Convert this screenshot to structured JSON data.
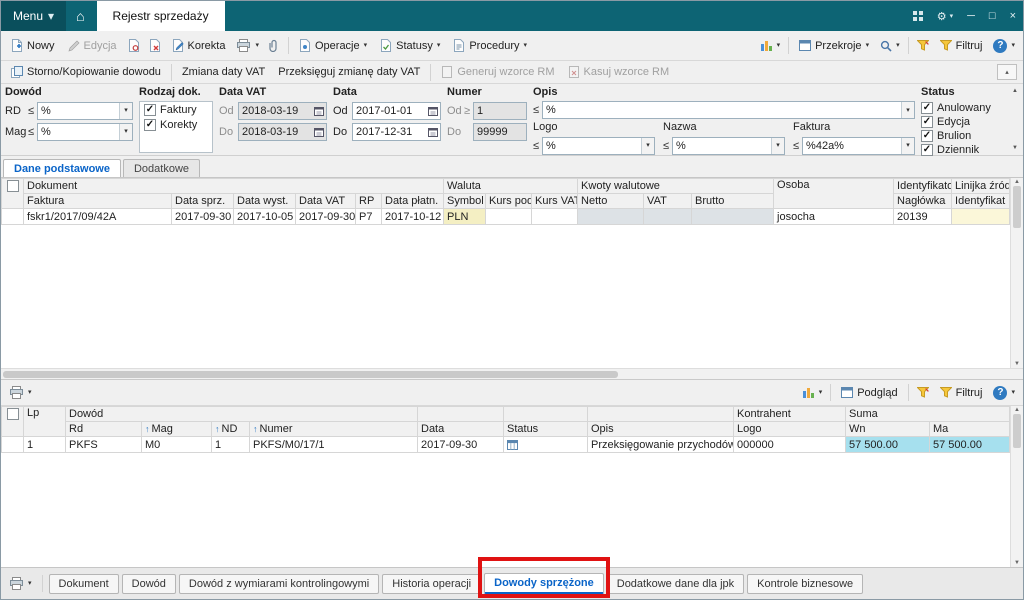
{
  "icons": {
    "home": "⌂",
    "gear": "⚙",
    "minimize": "─",
    "maximize": "□",
    "close": "×",
    "caret": "▾",
    "collapse": "▴",
    "scroll_up": "▲",
    "scroll_down": "▼",
    "check": "✓",
    "sort_asc": "↑",
    "help": "?"
  },
  "titlebar": {
    "menu": "Menu",
    "tab": "Rejestr sprzedaży"
  },
  "toolbar": {
    "nowy": "Nowy",
    "edycja": "Edycja",
    "korekta": "Korekta",
    "operacje": "Operacje",
    "statusy": "Statusy",
    "procedury": "Procedury",
    "przekroje": "Przekroje",
    "filtruj": "Filtruj"
  },
  "actions": {
    "storno": "Storno/Kopiowanie dowodu",
    "zmiana_vat": "Zmiana daty VAT",
    "przeksieguj": "Przeksięguj zmianę daty VAT",
    "generuj": "Generuj wzorce RM",
    "kasuj": "Kasuj wzorce RM"
  },
  "filters": {
    "dowod": {
      "label": "Dowód",
      "rd": "RD",
      "rd_op": "≤",
      "rd_value": "%",
      "mag": "Mag",
      "mag_op": "≤",
      "mag_value": "%"
    },
    "rodzaj": {
      "label": "Rodzaj dok.",
      "items": [
        "Faktury",
        "Korekty"
      ]
    },
    "data_vat": {
      "label": "Data VAT",
      "od": "Od",
      "od_value": "2018-03-19",
      "do": "Do",
      "do_value": "2018-03-19"
    },
    "data": {
      "label": "Data",
      "od": "Od",
      "od_value": "2017-01-01",
      "do": "Do",
      "do_value": "2017-12-31"
    },
    "numer": {
      "label": "Numer",
      "od": "Od",
      "od_op": "≥",
      "od_value": "1",
      "do": "Do",
      "do_value": "99999"
    },
    "opis": {
      "label": "Opis",
      "op": "≤",
      "value": "%"
    },
    "logo": {
      "label": "Logo",
      "op": "≤",
      "value": "%"
    },
    "nazwa": {
      "label": "Nazwa",
      "op": "≤",
      "value": "%"
    },
    "faktura": {
      "label": "Faktura",
      "op": "≤",
      "value": "%42a%"
    },
    "status": {
      "label": "Status",
      "items": [
        "Anulowany",
        "Edycja",
        "Brulion",
        "Dziennik"
      ]
    }
  },
  "view_tabs": {
    "active": "Dane podstawowe",
    "inactive": "Dodatkowe"
  },
  "upper_grid": {
    "groups": {
      "dokument": "Dokument",
      "waluta": "Waluta",
      "kwoty": "Kwoty walutowe",
      "osoba": "Osoba",
      "identyfikator": "Identyfikator",
      "linijka": "Linijka źród"
    },
    "cols": {
      "faktura": "Faktura",
      "data_sprz": "Data sprz.",
      "data_wyst": "Data wyst.",
      "data_vat": "Data VAT",
      "rp": "RP",
      "data_platn": "Data płatn.",
      "symbol": "Symbol",
      "kurs_pod": "Kurs pod.",
      "kurs_vat": "Kurs VAT",
      "netto": "Netto",
      "vat": "VAT",
      "brutto": "Brutto",
      "naglowka": "Nagłówka",
      "identyfikat": "Identyfikat"
    },
    "row": {
      "faktura": "fskr1/2017/09/42A",
      "data_sprz": "2017-09-30",
      "data_wyst": "2017-10-05",
      "data_vat": "2017-09-30",
      "rp": "P7",
      "data_platn": "2017-10-12",
      "symbol": "PLN",
      "osoba": "josocha",
      "naglowka": "20139"
    }
  },
  "preview_toolbar": {
    "podglad": "Podgląd",
    "filtruj": "Filtruj"
  },
  "lower_grid": {
    "groups": {
      "lp": "Lp",
      "dowod": "Dowód",
      "kontrahent": "Kontrahent",
      "suma": "Suma"
    },
    "cols": {
      "rd": "Rd",
      "mag": "Mag",
      "nd": "ND",
      "numer": "Numer",
      "data": "Data",
      "status": "Status",
      "opis": "Opis",
      "logo": "Logo",
      "wn": "Wn",
      "ma": "Ma"
    },
    "row": {
      "lp": "1",
      "rd": "PKFS",
      "mag": "M0",
      "nd": "1",
      "numer": "PKFS/M0/17/1",
      "data": "2017-09-30",
      "opis": "Przeksięgowanie przychodów ze",
      "logo": "000000",
      "wn": "57 500.00",
      "ma": "57 500.00"
    }
  },
  "bottom_tabs": [
    "Dokument",
    "Dowód",
    "Dowód z wymiarami kontrolingowymi",
    "Historia operacji",
    "Dowody sprzężone",
    "Dodatkowe dane dla jpk",
    "Kontrole biznesowe"
  ]
}
